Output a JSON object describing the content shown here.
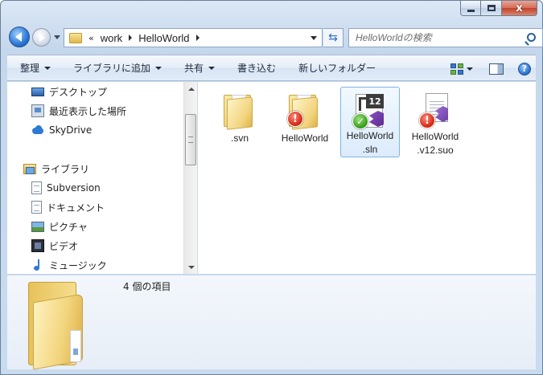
{
  "window": {
    "minimize_glyph": "",
    "maximize_glyph": "",
    "close_glyph": "x"
  },
  "nav": {
    "address": {
      "overflow": "«",
      "crumbs": [
        "work",
        "HelloWorld"
      ]
    },
    "search": {
      "placeholder": "HelloWorldの検索"
    }
  },
  "toolbar": {
    "organize": "整理",
    "add_to_library": "ライブラリに追加",
    "share": "共有",
    "burn": "書き込む",
    "new_folder": "新しいフォルダー",
    "help": "?"
  },
  "sidebar": {
    "favorites": [
      {
        "label": "デスクトップ",
        "icon": "desktop-icon"
      },
      {
        "label": "最近表示した場所",
        "icon": "recent-places-icon"
      },
      {
        "label": "SkyDrive",
        "icon": "skydrive-icon"
      }
    ],
    "library_header": {
      "label": "ライブラリ",
      "icon": "library-icon"
    },
    "libraries": [
      {
        "label": "Subversion",
        "icon": "document-library-icon"
      },
      {
        "label": "ドキュメント",
        "icon": "document-library-icon"
      },
      {
        "label": "ピクチャ",
        "icon": "pictures-library-icon"
      },
      {
        "label": "ビデオ",
        "icon": "videos-library-icon"
      },
      {
        "label": "ミュージック",
        "icon": "music-library-icon"
      }
    ]
  },
  "files": [
    {
      "name_line1": ".svn",
      "name_line2": "",
      "icon": "folder-icon",
      "overlay": "none",
      "selected": false
    },
    {
      "name_line1": "HelloWorld",
      "name_line2": "",
      "icon": "folder-icon",
      "overlay": "svn-modified-badge",
      "selected": false
    },
    {
      "name_line1": "HelloWorld",
      "name_line2": ".sln",
      "icon": "visual-studio-solution-icon",
      "overlay": "svn-normal-badge",
      "selected": true
    },
    {
      "name_line1": "HelloWorld",
      "name_line2": ".v12.suo",
      "icon": "visual-studio-suo-icon",
      "overlay": "svn-modified-badge",
      "selected": false
    }
  ],
  "vs_version_badge": "12",
  "badges": {
    "error": "!",
    "ok": "✓"
  },
  "details": {
    "status": "4 個の項目"
  },
  "colors": {
    "accent": "#2a77d6",
    "selection_border": "#7eb4ea",
    "svn_modified": "#d42a14",
    "svn_normal": "#3aa01e"
  }
}
